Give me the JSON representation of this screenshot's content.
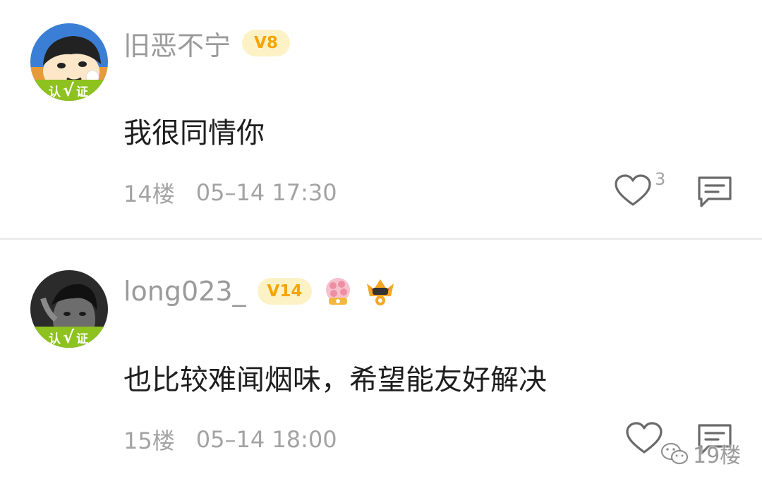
{
  "comments": [
    {
      "username": "旧恶不宁",
      "level": "V8",
      "verify_label_left": "认",
      "verify_label_check": "√",
      "verify_label_right": "证",
      "text": "我很同情你",
      "floor": "14楼",
      "time": "05–14 17:30",
      "like_count": "3",
      "icons": {
        "like": "heart-icon",
        "reply": "comment-icon"
      }
    },
    {
      "username": "long023_",
      "level": "V14",
      "verify_label_left": "认",
      "verify_label_check": "√",
      "verify_label_right": "证",
      "text": "也比较难闻烟味，希望能友好解决",
      "floor": "15楼",
      "time": "05–14 18:00",
      "badges": [
        "flower-medal-icon",
        "crown-medal-icon"
      ],
      "icons": {
        "like": "heart-icon",
        "reply": "comment-icon"
      }
    }
  ],
  "watermark": {
    "text": "19楼",
    "icon": "wechat-icon"
  },
  "colors": {
    "username": "#9a9a9a",
    "level_badge_bg": "#fdf2c6",
    "level_badge_text": "#f5a500",
    "verify_band": "#8dc21f",
    "comment_text": "#1e1e1e",
    "meta_text": "#a3a3a3",
    "divider": "#ececec"
  }
}
